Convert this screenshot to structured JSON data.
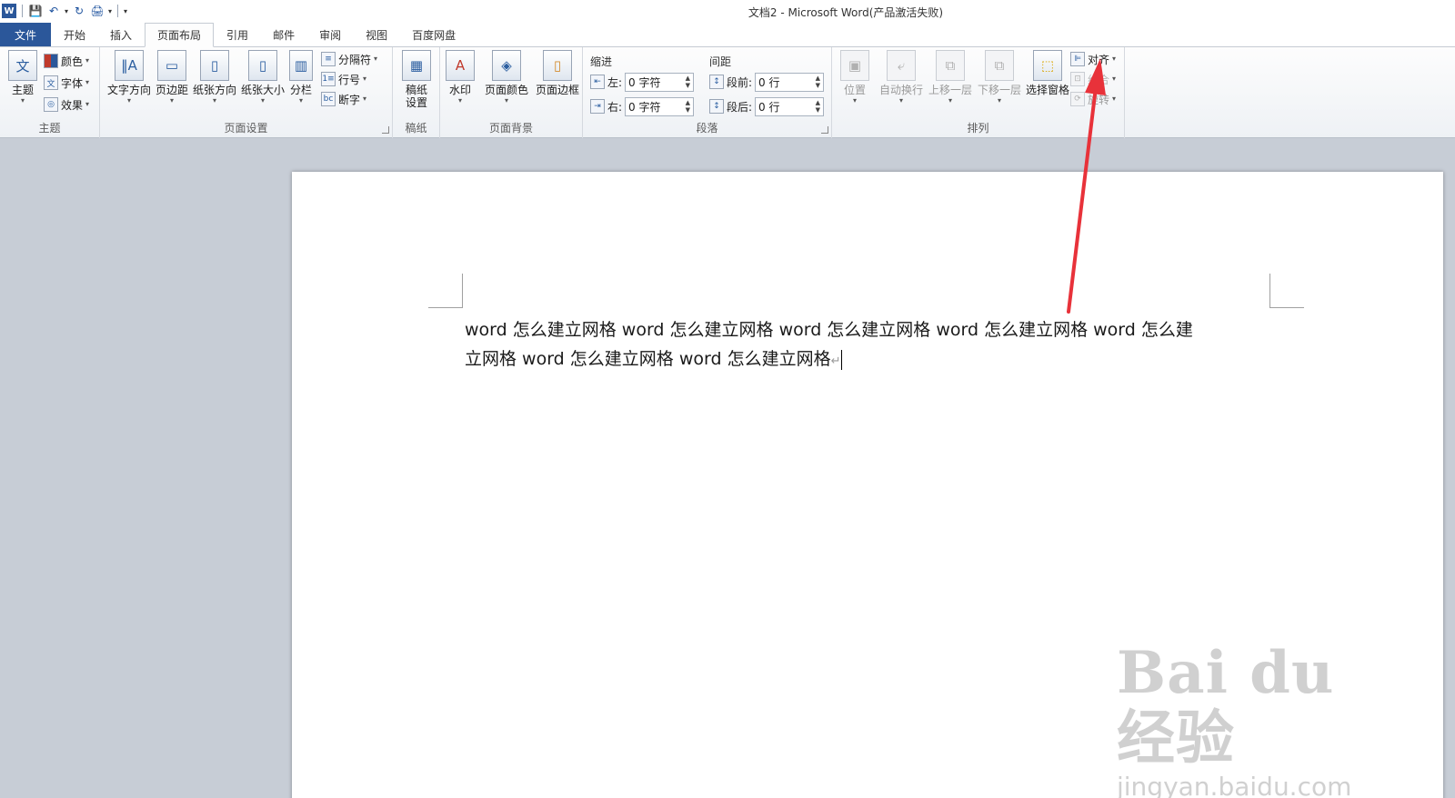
{
  "window": {
    "title": "文档2 - Microsoft Word(产品激活失败)"
  },
  "qat": {
    "icons": [
      "word-logo-icon",
      "save-icon",
      "undo-icon",
      "redo-icon",
      "quick-print-icon",
      "customize-qat-icon"
    ]
  },
  "tabs": [
    "文件",
    "开始",
    "插入",
    "页面布局",
    "引用",
    "邮件",
    "审阅",
    "视图",
    "百度网盘"
  ],
  "active_tab": "页面布局",
  "ribbon": {
    "theme_group": {
      "label": "主题",
      "theme_btn": "主题",
      "colors": "颜色",
      "fonts": "字体",
      "effects": "效果"
    },
    "page_setup_group": {
      "label": "页面设置",
      "text_direction": "文字方向",
      "margins": "页边距",
      "orientation": "纸张方向",
      "size": "纸张大小",
      "columns": "分栏",
      "breaks": "分隔符",
      "line_numbers": "行号",
      "hyphenation": "断字"
    },
    "manuscript_group": {
      "label": "稿纸",
      "manuscript_setup_line1": "稿纸",
      "manuscript_setup_line2": "设置"
    },
    "page_background_group": {
      "label": "页面背景",
      "watermark": "水印",
      "page_color": "页面颜色",
      "page_borders": "页面边框"
    },
    "paragraph_group": {
      "label": "段落",
      "indent_head": "缩进",
      "spacing_head": "间距",
      "indent_left_label": "左:",
      "indent_left_value": "0 字符",
      "indent_right_label": "右:",
      "indent_right_value": "0 字符",
      "space_before_label": "段前:",
      "space_before_value": "0 行",
      "space_after_label": "段后:",
      "space_after_value": "0 行"
    },
    "arrange_group": {
      "label": "排列",
      "position": "位置",
      "wrap_text": "自动换行",
      "bring_forward": "上移一层",
      "send_backward": "下移一层",
      "selection_pane": "选择窗格",
      "align": "对齐",
      "group": "组合",
      "rotate": "旋转"
    }
  },
  "document": {
    "line1": "word 怎么建立网格 word 怎么建立网格 word 怎么建立网格 word 怎么建立网格 word 怎么建",
    "line2": "立网格 word 怎么建立网格 word 怎么建立网格"
  },
  "watermark": {
    "logo": "Bai du 经验",
    "url": "jingyan.baidu.com"
  },
  "colors": {
    "accent": "#2b579a",
    "arrow": "#e8323a"
  }
}
